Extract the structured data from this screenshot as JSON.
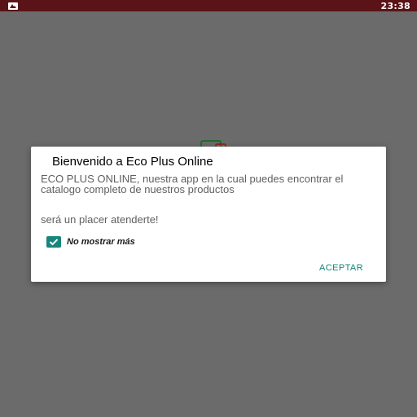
{
  "status_bar": {
    "time": "23:38",
    "icon": "notification-image-icon",
    "color": "#5a1418"
  },
  "dialog": {
    "title": "Bienvenido a Eco Plus Online",
    "message": "ECO PLUS ONLINE, nuestra app en la cual puedes encontrar el catalogo completo de nuestros productos",
    "message2": "será un placer atenderte!",
    "checkbox": {
      "label": "No mostrar más",
      "checked": true
    },
    "accept_label": "ACEPTAR"
  },
  "colors": {
    "accent": "#16857a",
    "overlay": "#6b6b6b"
  }
}
